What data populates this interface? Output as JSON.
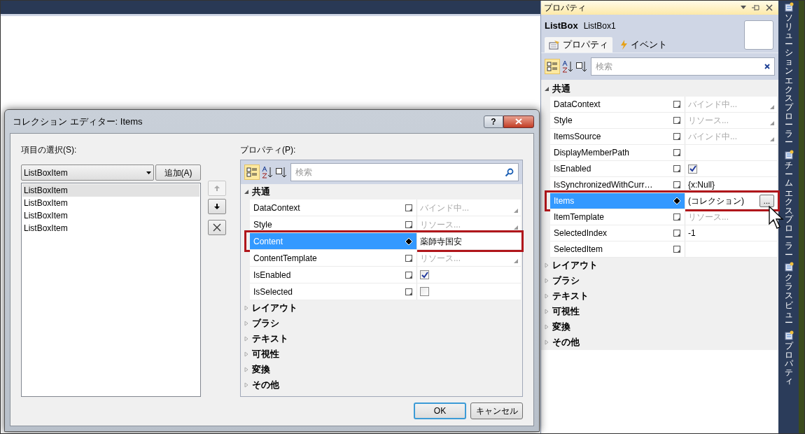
{
  "properties_panel": {
    "title": "プロパティ",
    "type_name": "ListBox",
    "element_name": "ListBox1",
    "tabs": [
      {
        "label": "プロパティ",
        "selected": true
      },
      {
        "label": "イベント",
        "selected": false
      }
    ],
    "search": {
      "placeholder": "検索"
    },
    "grid": {
      "categories": [
        {
          "label": "共通",
          "expanded": true,
          "rows": [
            {
              "name": "DataContext",
              "kind": "hint",
              "value": "バインド中...",
              "local_value": false,
              "selected": false
            },
            {
              "name": "Style",
              "kind": "hint",
              "value": "リソース...",
              "local_value": false,
              "selected": false
            },
            {
              "name": "ItemsSource",
              "kind": "hint",
              "value": "バインド中...",
              "local_value": false,
              "selected": false
            },
            {
              "name": "DisplayMemberPath",
              "kind": "empty",
              "local_value": false,
              "selected": false
            },
            {
              "name": "IsEnabled",
              "kind": "check",
              "checked": true,
              "local_value": false,
              "selected": false
            },
            {
              "name": "IsSynchronizedWithCurr…",
              "kind": "text",
              "value": "{x:Null}",
              "local_value": false,
              "selected": false
            },
            {
              "name": "Items",
              "kind": "collection",
              "value": "(コレクション)",
              "button": "...",
              "local_value": true,
              "selected": true,
              "highlighted": true
            },
            {
              "name": "ItemTemplate",
              "kind": "hint",
              "value": "リソース...",
              "local_value": false,
              "selected": false
            },
            {
              "name": "SelectedIndex",
              "kind": "text",
              "value": "-1",
              "local_value": false,
              "selected": false
            },
            {
              "name": "SelectedItem",
              "kind": "empty",
              "local_value": false,
              "selected": false
            }
          ]
        },
        {
          "label": "レイアウト",
          "expanded": false
        },
        {
          "label": "ブラシ",
          "expanded": false
        },
        {
          "label": "テキスト",
          "expanded": false
        },
        {
          "label": "可視性",
          "expanded": false
        },
        {
          "label": "変換",
          "expanded": false
        },
        {
          "label": "その他",
          "expanded": false
        }
      ]
    }
  },
  "side_tabs": [
    {
      "words": [
        "ソリューション",
        "エクスプローラー"
      ]
    },
    {
      "words": [
        "チーム",
        "エクスプローラー"
      ]
    },
    {
      "words": [
        "クラス",
        "ビュー"
      ]
    },
    {
      "words": [
        "プロパティ"
      ]
    }
  ],
  "dialog": {
    "title": "コレクション エディター: Items",
    "help_button": "?",
    "items_label": "項目の選択(S):",
    "type_combo": "ListBoxItem",
    "add_button": "追加(A)",
    "items": [
      {
        "label": "ListBoxItem",
        "selected": true
      },
      {
        "label": "ListBoxItem",
        "selected": false
      },
      {
        "label": "ListBoxItem",
        "selected": false
      },
      {
        "label": "ListBoxItem",
        "selected": false
      }
    ],
    "move_up_disabled": true,
    "properties_label": "プロパティ(P):",
    "search": {
      "placeholder": "検索"
    },
    "grid": {
      "categories": [
        {
          "label": "共通",
          "expanded": true,
          "rows": [
            {
              "name": "DataContext",
              "kind": "hint",
              "value": "バインド中...",
              "local_value": false,
              "selected": false
            },
            {
              "name": "Style",
              "kind": "hint",
              "value": "リソース...",
              "local_value": false,
              "selected": false
            },
            {
              "name": "Content",
              "kind": "text",
              "value": "薬師寺国安",
              "local_value": true,
              "selected": true,
              "highlighted": true
            },
            {
              "name": "ContentTemplate",
              "kind": "hint",
              "value": "リソース...",
              "local_value": false,
              "selected": false
            },
            {
              "name": "IsEnabled",
              "kind": "check",
              "checked": true,
              "local_value": false,
              "selected": false
            },
            {
              "name": "IsSelected",
              "kind": "check",
              "checked": false,
              "local_value": false,
              "selected": false
            }
          ]
        },
        {
          "label": "レイアウト",
          "expanded": false
        },
        {
          "label": "ブラシ",
          "expanded": false
        },
        {
          "label": "テキスト",
          "expanded": false
        },
        {
          "label": "可視性",
          "expanded": false
        },
        {
          "label": "変換",
          "expanded": false
        },
        {
          "label": "その他",
          "expanded": false
        }
      ]
    },
    "buttons": [
      {
        "label": "OK",
        "default": true
      },
      {
        "label": "キャンセル",
        "default": false
      }
    ]
  }
}
